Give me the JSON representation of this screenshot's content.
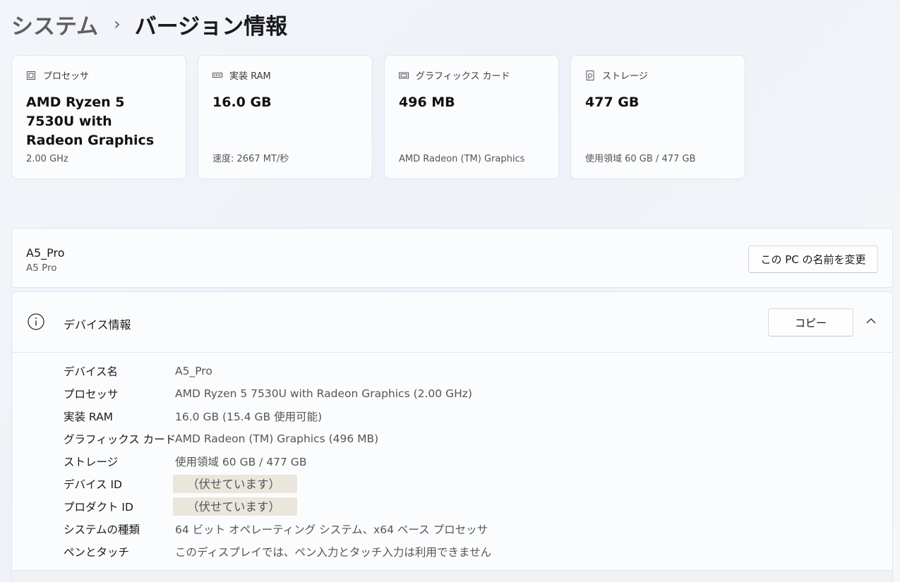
{
  "breadcrumb": {
    "parent": "システム",
    "separator": "›",
    "current": "バージョン情報"
  },
  "cards": [
    {
      "icon": "processor-icon",
      "label": "プロセッサ",
      "value": "AMD Ryzen 5 7530U with Radeon Graphics",
      "sub": "2.00 GHz"
    },
    {
      "icon": "ram-icon",
      "label": "実装 RAM",
      "value": "16.0 GB",
      "sub": "速度: 2667 MT/秒"
    },
    {
      "icon": "graphics-card-icon",
      "label": "グラフィックス カード",
      "value": "496 MB",
      "sub": "AMD Radeon (TM) Graphics"
    },
    {
      "icon": "storage-icon",
      "label": "ストレージ",
      "value": "477 GB",
      "sub": "使用領域 60 GB / 477 GB"
    }
  ],
  "device": {
    "name": "A5_Pro",
    "model": "A5 Pro",
    "rename_label": "この PC の名前を変更"
  },
  "device_info": {
    "title": "デバイス情報",
    "copy_label": "コピー",
    "rows": [
      {
        "label": "デバイス名",
        "value": "A5_Pro"
      },
      {
        "label": "プロセッサ",
        "value": "AMD Ryzen 5 7530U with Radeon Graphics (2.00 GHz)"
      },
      {
        "label": "実装 RAM",
        "value": "16.0 GB (15.4 GB 使用可能)"
      },
      {
        "label": "グラフィックス カード",
        "value": "AMD Radeon (TM) Graphics (496 MB)"
      },
      {
        "label": "ストレージ",
        "value": "使用領域 60 GB / 477 GB"
      },
      {
        "label": "デバイス ID",
        "value": "（伏せています）"
      },
      {
        "label": "プロダクト ID",
        "value": "（伏せています）"
      },
      {
        "label": "システムの種類",
        "value": "64 ビット オペレーティング システム、x64 ベース プロセッサ"
      },
      {
        "label": "ペンとタッチ",
        "value": "このディスプレイでは、ペン入力とタッチ入力は利用できません"
      }
    ]
  },
  "colors": {
    "masked_bg": "#ebe6dc",
    "card_bg": "#fbfcfe",
    "border": "#e2e4e9"
  }
}
